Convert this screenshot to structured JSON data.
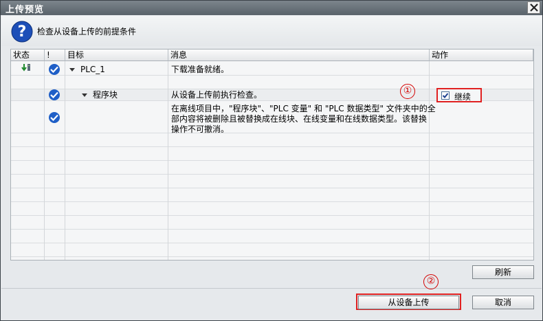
{
  "window": {
    "title": "上传预览"
  },
  "header": {
    "text": "检查从设备上传的前提条件",
    "icon": "question-icon"
  },
  "grid": {
    "columns": [
      "状态",
      "!",
      "目标",
      "消息",
      "动作"
    ],
    "rows": [
      {
        "status_icon": "download-arrow-icon",
        "check_icon": "check-circle-icon",
        "target": "PLC_1",
        "expanded": true,
        "message": "下载准备就绪。",
        "action": ""
      },
      {
        "status_icon": "",
        "check_icon": "check-circle-icon",
        "target": "程序块",
        "expanded": true,
        "message": "从设备上传前执行检查。",
        "action": {
          "checkbox_label": "继续",
          "checked": true
        }
      },
      {
        "status_icon": "",
        "check_icon": "check-circle-icon",
        "target": "",
        "message_lines": [
          "在离线项目中，\"程序块\"、\"PLC 变量\" 和 \"PLC 数据类型\" 文件夹中的全",
          "部内容将被删除且被替换成在线块、在线变量和在线数据类型。该替换",
          "操作不可撤消。"
        ]
      }
    ]
  },
  "markers": {
    "one": "①",
    "two": "②"
  },
  "buttons": {
    "refresh": "刷新",
    "upload": "从设备上传",
    "cancel": "取消"
  },
  "colors": {
    "highlight": "#e02020",
    "check": "#1f5fc7",
    "marker": "#d40000"
  }
}
